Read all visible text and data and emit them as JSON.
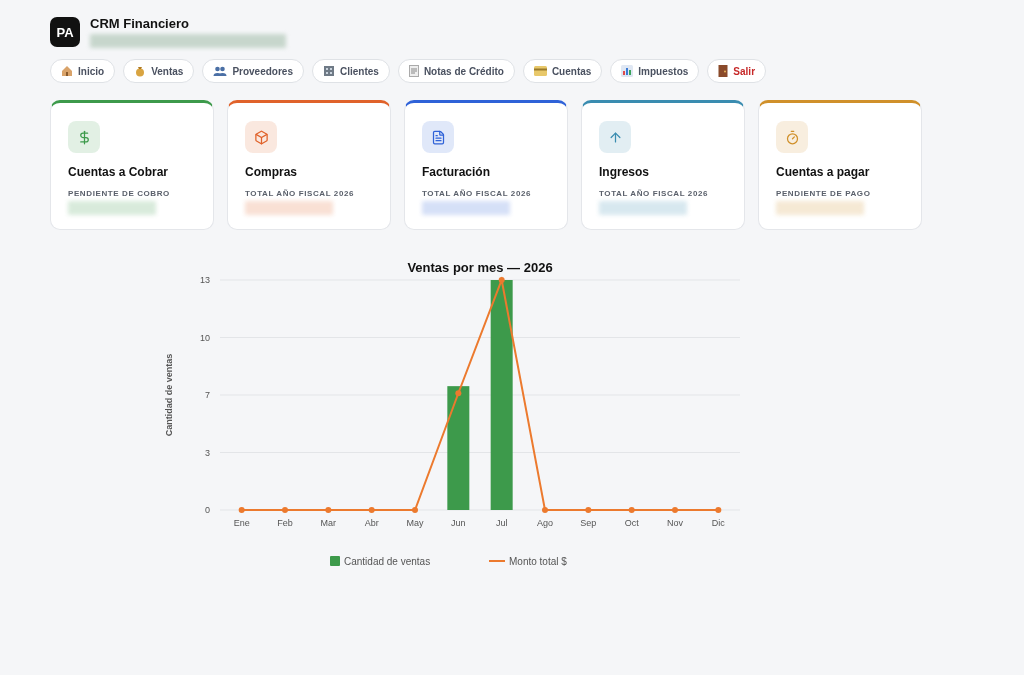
{
  "app": {
    "avatar": "PA",
    "title": "CRM Financiero"
  },
  "nav": [
    {
      "label": "Inicio",
      "kind": "normal"
    },
    {
      "label": "Ventas",
      "kind": "normal"
    },
    {
      "label": "Proveedores",
      "kind": "normal"
    },
    {
      "label": "Clientes",
      "kind": "normal"
    },
    {
      "label": "Notas de Crédito",
      "kind": "normal"
    },
    {
      "label": "Cuentas",
      "kind": "normal"
    },
    {
      "label": "Impuestos",
      "kind": "normal"
    },
    {
      "label": "Salir",
      "kind": "danger"
    }
  ],
  "cards": [
    {
      "title": "Cuentas a Cobrar",
      "subtitle": "PENDIENTE DE COBRO",
      "color": "#3d9a4b"
    },
    {
      "title": "Compras",
      "subtitle": "TOTAL AÑO FISCAL 2026",
      "color": "#e0622a"
    },
    {
      "title": "Facturación",
      "subtitle": "TOTAL AÑO FISCAL 2026",
      "color": "#2f62d8"
    },
    {
      "title": "Ingresos",
      "subtitle": "TOTAL AÑO FISCAL 2026",
      "color": "#3a8cb0"
    },
    {
      "title": "Cuentas a pagar",
      "subtitle": "PENDIENTE DE PAGO",
      "color": "#d0902a"
    }
  ],
  "chart": {
    "chart_data": {
      "type": "bar",
      "title": "Ventas por mes — 2026",
      "ylabel": "Cantidad de ventas",
      "categories": [
        "Ene",
        "Feb",
        "Mar",
        "Abr",
        "May",
        "Jun",
        "Jul",
        "Ago",
        "Sep",
        "Oct",
        "Nov",
        "Dic"
      ],
      "series": [
        {
          "name": "Cantidad de ventas",
          "color": "#3d9a4b",
          "values": [
            0,
            0,
            0,
            0,
            0,
            7,
            13,
            0,
            0,
            0,
            0,
            0
          ]
        },
        {
          "name": "Monto total $",
          "color": "#ec7a2e",
          "type": "line",
          "marker": true,
          "values": [
            0,
            0,
            0,
            0,
            0,
            6.6,
            13,
            0,
            0,
            0,
            0,
            0
          ]
        }
      ],
      "grid": true,
      "legend": "bottom",
      "ylim": [
        0,
        13
      ],
      "yticks": [
        0,
        {
          "value": 3.25,
          "label": "3"
        },
        {
          "value": 6.5,
          "label": "7"
        },
        {
          "value": 9.75,
          "label": "10"
        },
        13
      ]
    }
  }
}
